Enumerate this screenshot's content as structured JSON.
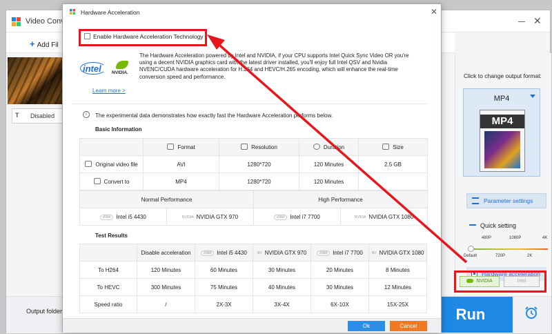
{
  "app": {
    "title": "Video Conv",
    "add_files_label": "Add Fil",
    "subtitle_label": "Disabled",
    "output_folder_label": "Output folder:",
    "run_label": "Run"
  },
  "right_panel": {
    "caption": "Click to change output format:",
    "format": "MP4",
    "format_icon_text": "MP4",
    "parameter_settings": "Parameter settings",
    "quick_setting": "Quick setting",
    "quality_ticks_top": [
      "480P",
      "1080P",
      "4K"
    ],
    "quality_ticks_bottom": [
      "Default",
      "720P",
      "2K"
    ],
    "hardware_acceleration_label": "Hardware acceleration",
    "hardware_acceleration_checked": true,
    "vendor_nvidia": "NVIDIA",
    "vendor_intel": "Intel"
  },
  "dialog": {
    "title": "Hardware Acceleration",
    "enable_label": "Enable Hardware Acceleration Technology",
    "enable_checked": false,
    "intel_logo_text": "intel",
    "nvidia_logo_text": "NVIDIA.",
    "intro": "The Hardware Acceleration powered by Intel and NVIDIA, if your CPU supports Intel Quick Sync Video OR you're using a decent NVIDIA graphics card with the latest driver installed, you'll enjoy full Intel QSV and Nvidia NVENC/CUDA hardware acceleration for H.264 and HEVC/H.265 encoding, which will enhance the real-time conversion speed and performance.",
    "learn_more": "Learn more >",
    "info_note": "The experimental data demonstrates how exactly fast the Hardware Acceleration performs below.",
    "basic_info_title": "Basic Information",
    "basic_headers": [
      "Format",
      "Resolution",
      "Duration",
      "Size"
    ],
    "basic_rows": [
      {
        "label": "Original video file",
        "format": "AVI",
        "resolution": "1280*720",
        "duration": "120 Minutes",
        "size": "2.5 GB"
      },
      {
        "label": "Convert to",
        "format": "MP4",
        "resolution": "1280*720",
        "duration": "120 Minutes",
        "size": ""
      }
    ],
    "normal_performance": "Normal Performance",
    "high_performance": "High Performance",
    "hardware": {
      "intel_i5": "Intel i5 4430",
      "gtx970": "NVIDIA GTX 970",
      "intel_i7": "Intel i7 7700",
      "gtx1080": "NVIDIA GTX 1080"
    },
    "test_results_title": "Test Results",
    "test_headers": [
      "Disable acceleration",
      "Intel i5 4430",
      "NVIDIA GTX 970",
      "Intel i7 7700",
      "NVIDIA GTX 1080"
    ],
    "test_rows": [
      {
        "label": "To H264",
        "values": [
          "120 Minutes",
          "60 Minutes",
          "30 Minutes",
          "20 Minutes",
          "8 Minutes"
        ]
      },
      {
        "label": "To HEVC",
        "values": [
          "300 Minutes",
          "75 Minutes",
          "40 Minutes",
          "30 Minutes",
          "12 Minutes"
        ]
      },
      {
        "label": "Speed ratio",
        "values": [
          "/",
          "2X-3X",
          "3X-4X",
          "6X-10X",
          "15X-25X"
        ]
      }
    ],
    "ok_label": "Ok",
    "cancel_label": "Cancel"
  },
  "colors": {
    "accent": "#1e88e5",
    "annotation_red": "#e8161c",
    "cancel_orange": "#f07a22",
    "nvidia_green": "#76b900"
  }
}
